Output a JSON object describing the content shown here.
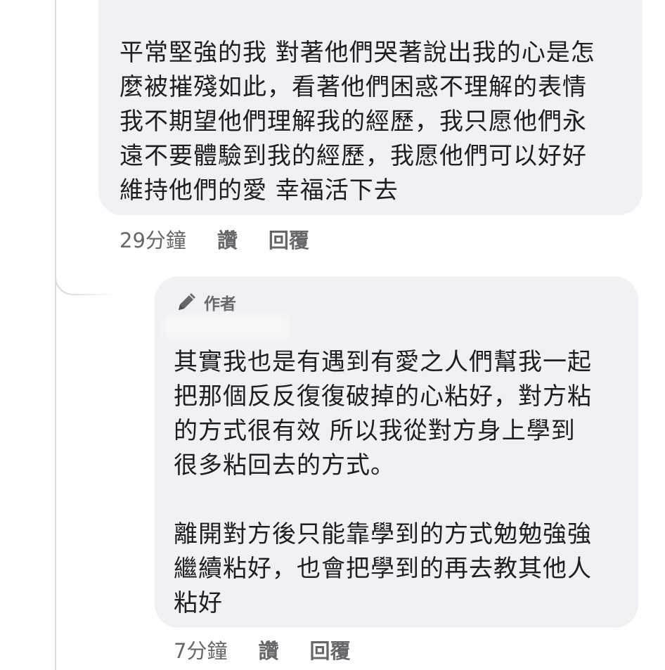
{
  "top_comment": {
    "text": "平常堅強的我 對著他們哭著說出我的心是怎\n麼被摧殘如此，看著他們困惑不理解的表情\n我不期望他們理解我的經歷，我只愿他們永\n遠不要體驗到我的經歷，我愿他們可以好好\n維持他們的愛 幸福活下去",
    "time": "29分鐘",
    "like_label": "讚",
    "reply_label": "回覆"
  },
  "reply_comment": {
    "badge_icon": "pencil-icon",
    "badge_label": "作者",
    "text": "其實我也是有遇到有愛之人們幫我一起\n把那個反反復復破掉的心粘好，對方粘\n的方式很有效 所以我從對方身上學到\n很多粘回去的方式。\n\n離開對方後只能靠學到的方式勉勉強強\n繼續粘好，也會把學到的再去教其他人\n粘好",
    "time": "7分鐘",
    "like_label": "讚",
    "reply_label": "回覆"
  },
  "colors": {
    "bubble_bg": "#f0f1f5",
    "text": "#1c1e21",
    "meta": "#65676b",
    "thread_line": "#d9dbe0"
  }
}
